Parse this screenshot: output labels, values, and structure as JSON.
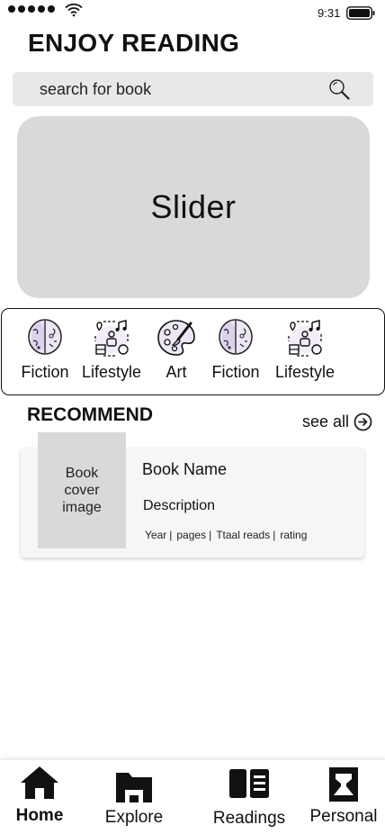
{
  "status_bar": {
    "time": "9:31",
    "signal_icon": "signal-dots-icon",
    "wifi_icon": "wifi-icon",
    "battery_icon": "battery-icon"
  },
  "header": {
    "title": "ENJOY READING"
  },
  "search": {
    "placeholder": "search for book",
    "icon": "search-icon"
  },
  "slider": {
    "label": "Slider"
  },
  "categories": [
    {
      "label": "Fiction",
      "icon": "brain-icon"
    },
    {
      "label": "Lifestyle",
      "icon": "lifestyle-icon"
    },
    {
      "label": "Art",
      "icon": "palette-icon"
    },
    {
      "label": "Fiction",
      "icon": "brain-icon"
    },
    {
      "label": "Lifestyle",
      "icon": "lifestyle-icon"
    }
  ],
  "recommend": {
    "title": "RECOMMEND",
    "see_all": "see all",
    "book": {
      "cover": "Book cover image",
      "name": "Book Name",
      "description": "Description",
      "meta": [
        "Year",
        "pages",
        "Ttaal reads",
        "rating"
      ],
      "separator": "|"
    }
  },
  "nav": {
    "active": "Home",
    "items": [
      {
        "label": "Home",
        "icon": "home-icon"
      },
      {
        "label": "Explore",
        "icon": "folder-icon"
      },
      {
        "label": "Readings",
        "icon": "book-open-icon"
      },
      {
        "label": "Personal",
        "icon": "person-icon"
      }
    ]
  },
  "colors": {
    "placeholder_gray": "#d9d9d9",
    "search_bg": "#e8e8ea",
    "text": "#111111"
  }
}
